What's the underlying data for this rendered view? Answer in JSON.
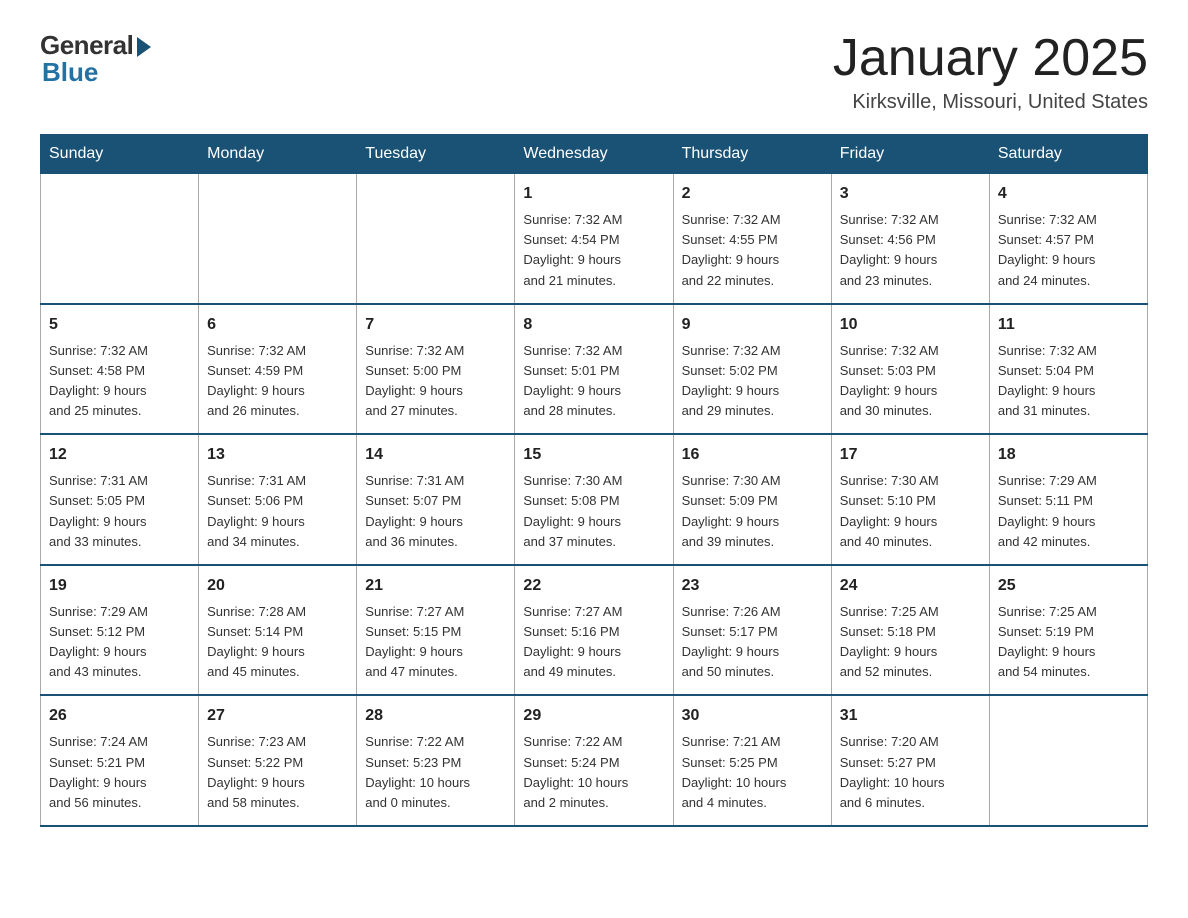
{
  "logo": {
    "general": "General",
    "blue": "Blue"
  },
  "title": "January 2025",
  "location": "Kirksville, Missouri, United States",
  "days_of_week": [
    "Sunday",
    "Monday",
    "Tuesday",
    "Wednesday",
    "Thursday",
    "Friday",
    "Saturday"
  ],
  "weeks": [
    [
      {
        "day": "",
        "info": ""
      },
      {
        "day": "",
        "info": ""
      },
      {
        "day": "",
        "info": ""
      },
      {
        "day": "1",
        "info": "Sunrise: 7:32 AM\nSunset: 4:54 PM\nDaylight: 9 hours\nand 21 minutes."
      },
      {
        "day": "2",
        "info": "Sunrise: 7:32 AM\nSunset: 4:55 PM\nDaylight: 9 hours\nand 22 minutes."
      },
      {
        "day": "3",
        "info": "Sunrise: 7:32 AM\nSunset: 4:56 PM\nDaylight: 9 hours\nand 23 minutes."
      },
      {
        "day": "4",
        "info": "Sunrise: 7:32 AM\nSunset: 4:57 PM\nDaylight: 9 hours\nand 24 minutes."
      }
    ],
    [
      {
        "day": "5",
        "info": "Sunrise: 7:32 AM\nSunset: 4:58 PM\nDaylight: 9 hours\nand 25 minutes."
      },
      {
        "day": "6",
        "info": "Sunrise: 7:32 AM\nSunset: 4:59 PM\nDaylight: 9 hours\nand 26 minutes."
      },
      {
        "day": "7",
        "info": "Sunrise: 7:32 AM\nSunset: 5:00 PM\nDaylight: 9 hours\nand 27 minutes."
      },
      {
        "day": "8",
        "info": "Sunrise: 7:32 AM\nSunset: 5:01 PM\nDaylight: 9 hours\nand 28 minutes."
      },
      {
        "day": "9",
        "info": "Sunrise: 7:32 AM\nSunset: 5:02 PM\nDaylight: 9 hours\nand 29 minutes."
      },
      {
        "day": "10",
        "info": "Sunrise: 7:32 AM\nSunset: 5:03 PM\nDaylight: 9 hours\nand 30 minutes."
      },
      {
        "day": "11",
        "info": "Sunrise: 7:32 AM\nSunset: 5:04 PM\nDaylight: 9 hours\nand 31 minutes."
      }
    ],
    [
      {
        "day": "12",
        "info": "Sunrise: 7:31 AM\nSunset: 5:05 PM\nDaylight: 9 hours\nand 33 minutes."
      },
      {
        "day": "13",
        "info": "Sunrise: 7:31 AM\nSunset: 5:06 PM\nDaylight: 9 hours\nand 34 minutes."
      },
      {
        "day": "14",
        "info": "Sunrise: 7:31 AM\nSunset: 5:07 PM\nDaylight: 9 hours\nand 36 minutes."
      },
      {
        "day": "15",
        "info": "Sunrise: 7:30 AM\nSunset: 5:08 PM\nDaylight: 9 hours\nand 37 minutes."
      },
      {
        "day": "16",
        "info": "Sunrise: 7:30 AM\nSunset: 5:09 PM\nDaylight: 9 hours\nand 39 minutes."
      },
      {
        "day": "17",
        "info": "Sunrise: 7:30 AM\nSunset: 5:10 PM\nDaylight: 9 hours\nand 40 minutes."
      },
      {
        "day": "18",
        "info": "Sunrise: 7:29 AM\nSunset: 5:11 PM\nDaylight: 9 hours\nand 42 minutes."
      }
    ],
    [
      {
        "day": "19",
        "info": "Sunrise: 7:29 AM\nSunset: 5:12 PM\nDaylight: 9 hours\nand 43 minutes."
      },
      {
        "day": "20",
        "info": "Sunrise: 7:28 AM\nSunset: 5:14 PM\nDaylight: 9 hours\nand 45 minutes."
      },
      {
        "day": "21",
        "info": "Sunrise: 7:27 AM\nSunset: 5:15 PM\nDaylight: 9 hours\nand 47 minutes."
      },
      {
        "day": "22",
        "info": "Sunrise: 7:27 AM\nSunset: 5:16 PM\nDaylight: 9 hours\nand 49 minutes."
      },
      {
        "day": "23",
        "info": "Sunrise: 7:26 AM\nSunset: 5:17 PM\nDaylight: 9 hours\nand 50 minutes."
      },
      {
        "day": "24",
        "info": "Sunrise: 7:25 AM\nSunset: 5:18 PM\nDaylight: 9 hours\nand 52 minutes."
      },
      {
        "day": "25",
        "info": "Sunrise: 7:25 AM\nSunset: 5:19 PM\nDaylight: 9 hours\nand 54 minutes."
      }
    ],
    [
      {
        "day": "26",
        "info": "Sunrise: 7:24 AM\nSunset: 5:21 PM\nDaylight: 9 hours\nand 56 minutes."
      },
      {
        "day": "27",
        "info": "Sunrise: 7:23 AM\nSunset: 5:22 PM\nDaylight: 9 hours\nand 58 minutes."
      },
      {
        "day": "28",
        "info": "Sunrise: 7:22 AM\nSunset: 5:23 PM\nDaylight: 10 hours\nand 0 minutes."
      },
      {
        "day": "29",
        "info": "Sunrise: 7:22 AM\nSunset: 5:24 PM\nDaylight: 10 hours\nand 2 minutes."
      },
      {
        "day": "30",
        "info": "Sunrise: 7:21 AM\nSunset: 5:25 PM\nDaylight: 10 hours\nand 4 minutes."
      },
      {
        "day": "31",
        "info": "Sunrise: 7:20 AM\nSunset: 5:27 PM\nDaylight: 10 hours\nand 6 minutes."
      },
      {
        "day": "",
        "info": ""
      }
    ]
  ]
}
